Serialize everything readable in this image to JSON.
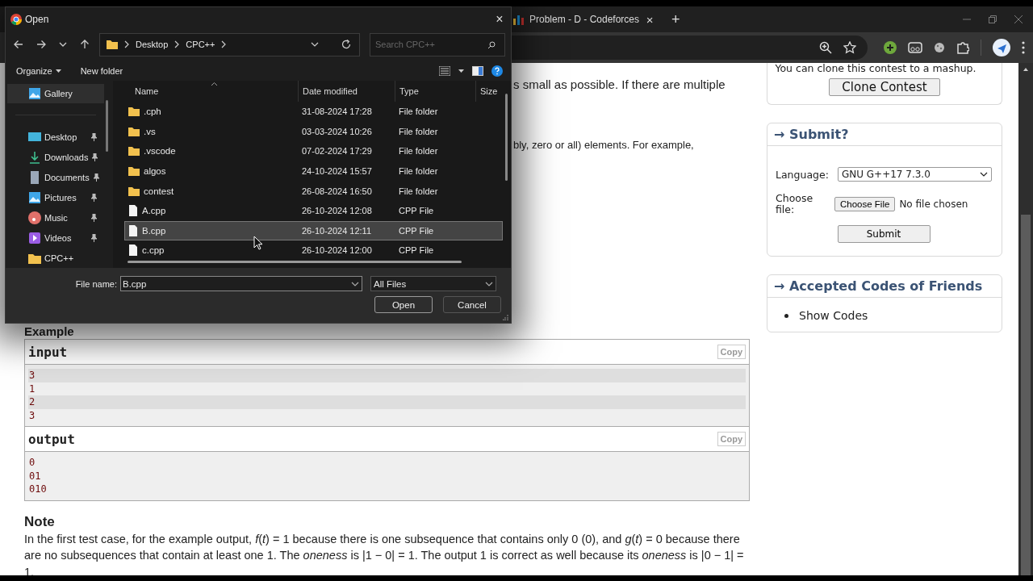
{
  "browser": {
    "tabs": [
      {
        "title": "Problem - D - Codeforces",
        "selected": false,
        "close": "×"
      }
    ],
    "new_tab": "+"
  },
  "dialog": {
    "title": "Open",
    "close": "×",
    "breadcrumb": [
      "Desktop",
      "CPC++"
    ],
    "search": {
      "placeholder": "Search CPC++"
    },
    "commands": [
      "Organize",
      "New folder"
    ],
    "nav": [
      {
        "label": "Gallery",
        "kind": "gallery",
        "selected": true,
        "pinned": false
      },
      {
        "label": "Desktop",
        "kind": "desktop",
        "selected": false,
        "pinned": true
      },
      {
        "label": "Downloads",
        "kind": "downloads",
        "selected": false,
        "pinned": true
      },
      {
        "label": "Documents",
        "kind": "documents",
        "selected": false,
        "pinned": true
      },
      {
        "label": "Pictures",
        "kind": "pictures",
        "selected": false,
        "pinned": true
      },
      {
        "label": "Music",
        "kind": "music",
        "selected": false,
        "pinned": true
      },
      {
        "label": "Videos",
        "kind": "videos",
        "selected": false,
        "pinned": true
      },
      {
        "label": "CPC++",
        "kind": "folder",
        "selected": false,
        "pinned": false
      }
    ],
    "columns": [
      "Name",
      "Date modified",
      "Type",
      "Size"
    ],
    "files": [
      {
        "name": ".cph",
        "date": "31-08-2024 17:28",
        "type": "File folder",
        "kind": "folder",
        "selected": false
      },
      {
        "name": ".vs",
        "date": "03-03-2024 10:26",
        "type": "File folder",
        "kind": "folder",
        "selected": false
      },
      {
        "name": ".vscode",
        "date": "07-02-2024 17:29",
        "type": "File folder",
        "kind": "folder",
        "selected": false
      },
      {
        "name": "algos",
        "date": "24-10-2024 15:57",
        "type": "File folder",
        "kind": "folder",
        "selected": false
      },
      {
        "name": "contest",
        "date": "26-08-2024 16:50",
        "type": "File folder",
        "kind": "folder",
        "selected": false
      },
      {
        "name": "A.cpp",
        "date": "26-10-2024 12:08",
        "type": "CPP File",
        "kind": "file",
        "selected": false
      },
      {
        "name": "B.cpp",
        "date": "26-10-2024 12:11",
        "type": "CPP File",
        "kind": "file",
        "selected": true
      },
      {
        "name": "c.cpp",
        "date": "26-10-2024 12:00",
        "type": "CPP File",
        "kind": "file",
        "selected": false
      }
    ],
    "file_name": {
      "label": "File name:",
      "value": "B.cpp"
    },
    "filter": "All Files",
    "buttons": [
      "Open",
      "Cancel"
    ]
  },
  "problem": {
    "fragments": [
      "s small as possible. If there are multiple",
      "bly, zero or all) elements. For example,"
    ],
    "example": {
      "title": "Example",
      "blocks": [
        {
          "title": "input",
          "copy": "Copy",
          "lines": [
            "3",
            "1",
            "2",
            "3"
          ]
        },
        {
          "title": "output",
          "copy": "Copy",
          "lines": [
            "0",
            "01",
            "010"
          ]
        }
      ]
    },
    "note": {
      "title": "Note",
      "text": "In the first test case, for the example output, *f*(*t*) = 1 because there is one subsequence that contains only 0 (0), and *g*(*t*) = 0 because there are no subsequences that contain at least one 1. The *oneness* is |1 − 0| = 1. The output 1 is correct as well because its *oneness* is |0 − 1| = 1."
    }
  },
  "sidebar": {
    "clone": {
      "text": "You can clone this contest to a mashup.",
      "button": "Clone Contest"
    },
    "submit": {
      "title": "→ Submit?",
      "language_label": "Language:",
      "language": "GNU G++17 7.3.0",
      "file_label": "Choose file:",
      "file_button": "Choose File",
      "file_status": "No file chosen",
      "button": "Submit"
    },
    "friends": {
      "title": "→ Accepted Codes of Friends",
      "links": [
        "Show Codes"
      ]
    }
  }
}
